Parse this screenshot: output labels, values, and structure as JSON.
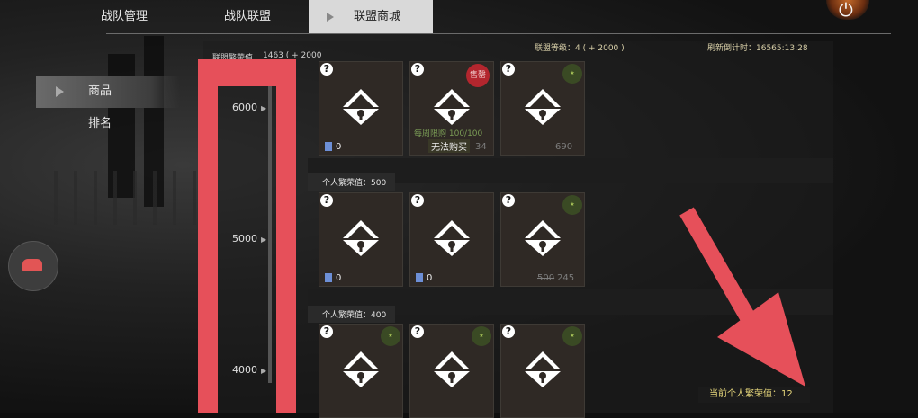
{
  "nav": {
    "tabs": [
      {
        "label": "战队管理"
      },
      {
        "label": "战队联盟"
      },
      {
        "label": "联盟商城"
      }
    ]
  },
  "sidebar": {
    "items": [
      {
        "label": "商品"
      },
      {
        "label": "排名"
      }
    ]
  },
  "header": {
    "prosperity_label": "联盟繁荣值",
    "prosperity_value": "1463 ( + 2000",
    "alliance_level": "联盟等级：4 ( + 2000 )",
    "refresh": "刷新倒计时：16565:13:28"
  },
  "levels": [
    "6000",
    "5000",
    "4000"
  ],
  "sections": [
    {
      "label": "个人繁荣值：500"
    },
    {
      "label": "个人繁荣值：400"
    }
  ],
  "cards": {
    "r1c1_count": "0",
    "r1c2_soldout": "售罄",
    "r1c2_limit": "每周限购 100/100",
    "r1c2_price": "34",
    "r1c2_action": "无法购买",
    "r1c3_price": "690",
    "r2c1_count": "0",
    "r2c2_count": "0",
    "r2c3_price": "245",
    "r2c3_old": "500"
  },
  "footer": {
    "personal": "当前个人繁荣值：12"
  },
  "colors": {
    "annotation_red": "#e6505a",
    "active_tab": "#d9d9d9"
  }
}
